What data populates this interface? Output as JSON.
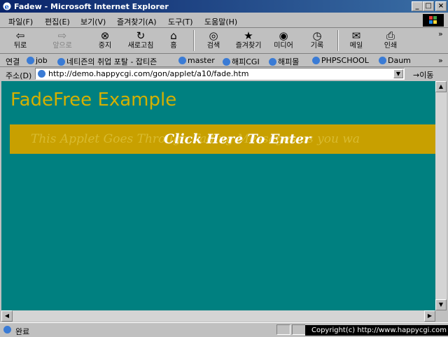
{
  "window": {
    "title": "Fadew - Microsoft Internet Explorer",
    "min_label": "_",
    "max_label": "□",
    "close_label": "×"
  },
  "menu": [
    {
      "label": "파일(F)"
    },
    {
      "label": "편집(E)"
    },
    {
      "label": "보기(V)"
    },
    {
      "label": "즐겨찾기(A)"
    },
    {
      "label": "도구(T)"
    },
    {
      "label": "도움말(H)"
    }
  ],
  "toolbar": {
    "back": {
      "label": "뒤로",
      "glyph": "⇦"
    },
    "forward": {
      "label": "앞으로",
      "glyph": "⇨"
    },
    "stop": {
      "label": "중지",
      "glyph": "⊗"
    },
    "refresh": {
      "label": "새로고침",
      "glyph": "↻"
    },
    "home": {
      "label": "홈",
      "glyph": "⌂"
    },
    "search": {
      "label": "검색",
      "glyph": "◎"
    },
    "favorites": {
      "label": "즐겨찾기",
      "glyph": "★"
    },
    "media": {
      "label": "미디어",
      "glyph": "◉"
    },
    "history": {
      "label": "기록",
      "glyph": "◷"
    },
    "mail": {
      "label": "메일",
      "glyph": "✉"
    },
    "print": {
      "label": "인쇄",
      "glyph": "⎙"
    },
    "more": "»"
  },
  "links": {
    "label": "연결",
    "items": [
      {
        "label": "job"
      },
      {
        "label": "네티즌의 취업 포탈 - 잡티즌"
      },
      {
        "label": "master"
      },
      {
        "label": "해피CGI"
      },
      {
        "label": "해피몰"
      },
      {
        "label": "PHPSCHOOL"
      },
      {
        "label": "Daum"
      }
    ],
    "more": "»"
  },
  "address": {
    "label": "주소(D)",
    "value": "http://demo.happycgi.com/gon/applet/a10/fade.htm",
    "go_label": "이동"
  },
  "page": {
    "heading": "FadeFree Example",
    "applet_fade_text": "This Applet Goes Through Fading Messages as you wa",
    "applet_click_text": "Click Here To Enter"
  },
  "status": {
    "text": "완료",
    "copyright": "Copyright(c) http://www.happycgi.com"
  },
  "colors": {
    "page_bg": "#008080",
    "heading": "#d4b000",
    "applet_bg": "#c8a000"
  }
}
